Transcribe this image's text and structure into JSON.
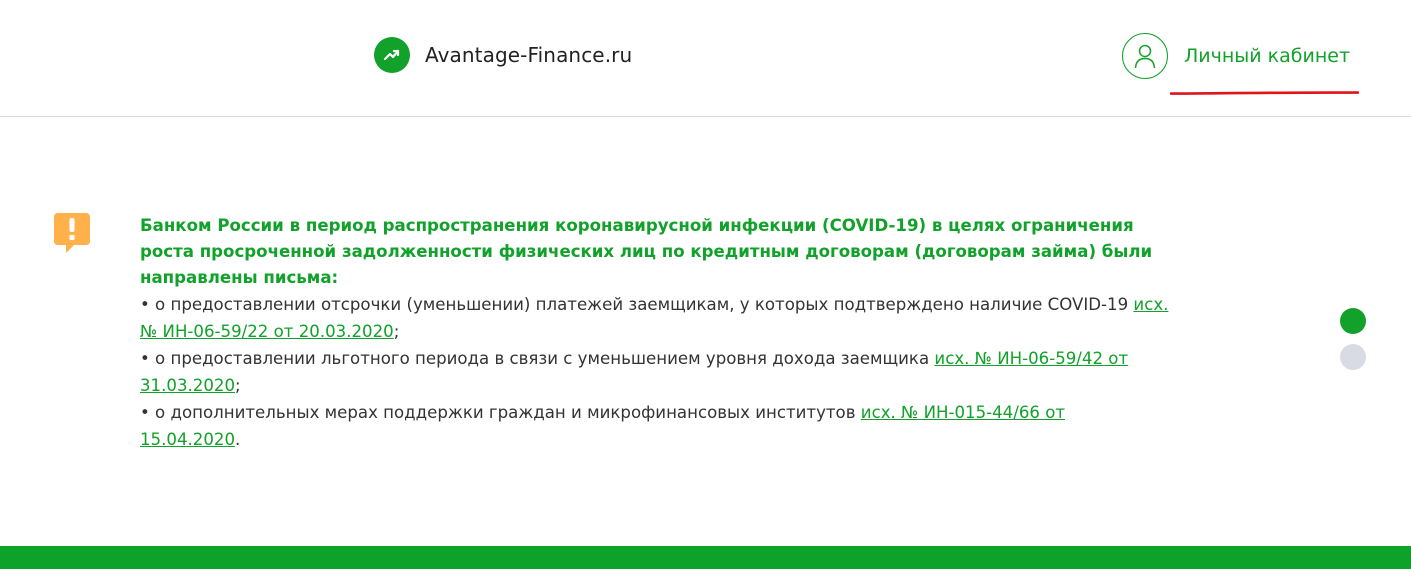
{
  "header": {
    "logo_text": "Avantage-Finance.ru",
    "account_label": "Личный кабинет"
  },
  "notice": {
    "title": "Банком России в период распространения коронавирусной инфекции (COVID-19) в целях ограничения роста просроченной задолженности физических лиц по кредитным договорам (договорам займа) были направлены письма:",
    "items": [
      {
        "text": "• о предоставлении отсрочки (уменьшении) платежей заемщикам, у которых подтверждено наличие COVID-19 ",
        "link": "исх. № ИН-06-59/22 от 20.03.2020",
        "suffix": ";"
      },
      {
        "text": "• о предоставлении льготного периода в связи с уменьшением уровня дохода заемщика ",
        "link": "исх. № ИН-06-59/42 от 31.03.2020",
        "suffix": ";"
      },
      {
        "text": "• о дополнительных мерах поддержки граждан и микрофинансовых институтов ",
        "link": "исх. № ИН-015-44/66 от 15.04.2020",
        "suffix": "."
      }
    ]
  },
  "slider": {
    "slide_count": 2,
    "active_index": 0
  },
  "colors": {
    "brand_green": "#12a12a",
    "warning_orange": "#ffb14a",
    "underline_red": "#e0141a",
    "footer_green": "#0da22a"
  }
}
